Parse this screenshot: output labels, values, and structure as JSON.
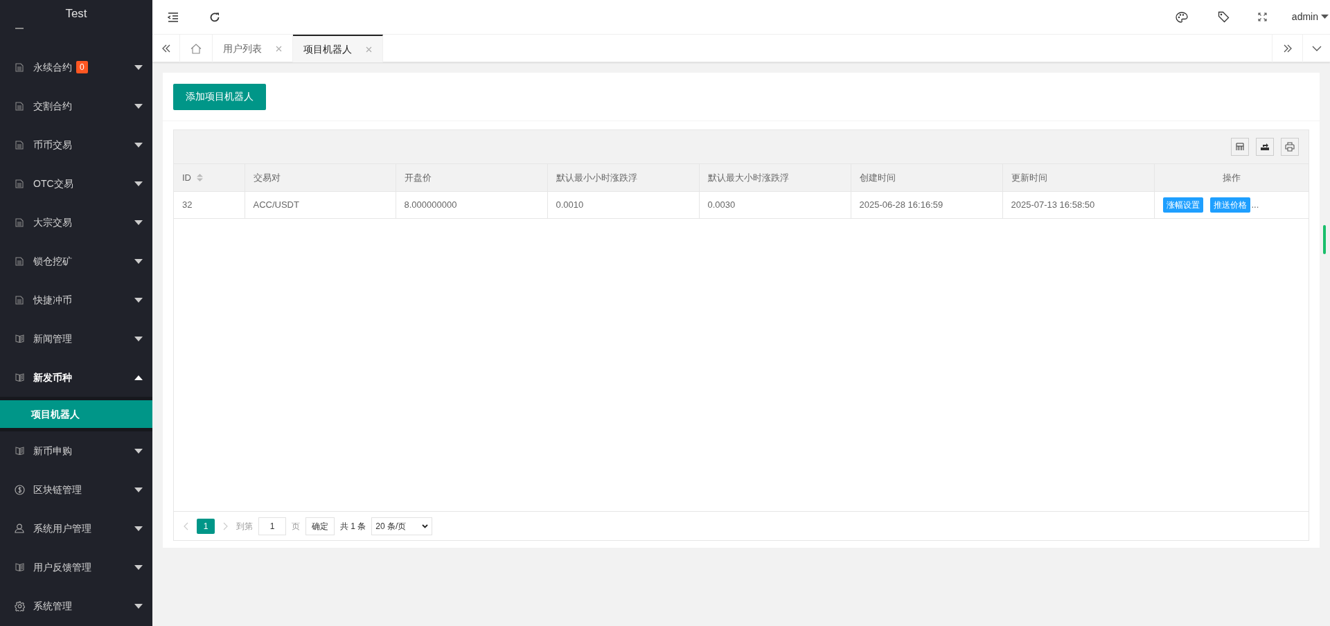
{
  "sidebar": {
    "logo": "Test",
    "menu": [
      {
        "label": "永续合约",
        "badge": "0",
        "expanded": false
      },
      {
        "label": "交割合约",
        "expanded": false
      },
      {
        "label": "币币交易",
        "expanded": false
      },
      {
        "label": "OTC交易",
        "expanded": false
      },
      {
        "label": "大宗交易",
        "expanded": false
      },
      {
        "label": "锁仓挖矿",
        "expanded": false
      },
      {
        "label": "快捷冲币",
        "expanded": false
      },
      {
        "label": "新闻管理",
        "expanded": false
      },
      {
        "label": "新发币种",
        "expanded": true,
        "children": [
          {
            "label": "项目机器人",
            "selected": true
          }
        ]
      },
      {
        "label": "新币申购",
        "expanded": false
      },
      {
        "label": "区块链管理",
        "expanded": false
      },
      {
        "label": "系统用户管理",
        "expanded": false
      },
      {
        "label": "用户反馈管理",
        "expanded": false
      },
      {
        "label": "系统管理",
        "expanded": false
      }
    ]
  },
  "header": {
    "user": "admin"
  },
  "tabs": [
    {
      "label": "用户列表",
      "selected": false
    },
    {
      "label": "项目机器人",
      "selected": true
    }
  ],
  "add_button": "添加项目机器人",
  "table": {
    "columns": [
      "ID",
      "交易对",
      "开盘价",
      "默认最小小时涨跌浮",
      "默认最大小时涨跌浮",
      "创建时间",
      "更新时间",
      "操作"
    ],
    "rows": [
      {
        "cells": [
          "32",
          "ACC/USDT",
          "8.000000000",
          "0.0010",
          "0.0030",
          "2025-06-28 16:16:59",
          "2025-07-13 16:58:50"
        ],
        "actions": [
          "涨幅设置",
          "推送价格"
        ],
        "more": "..."
      }
    ]
  },
  "pagination": {
    "pages": [
      {
        "label": "1",
        "selected": true
      }
    ],
    "goto_label": "到第",
    "goto_value": "1",
    "page_unit": "页",
    "confirm": "确定",
    "total": "共 1 条",
    "page_size": "20 条/页"
  }
}
